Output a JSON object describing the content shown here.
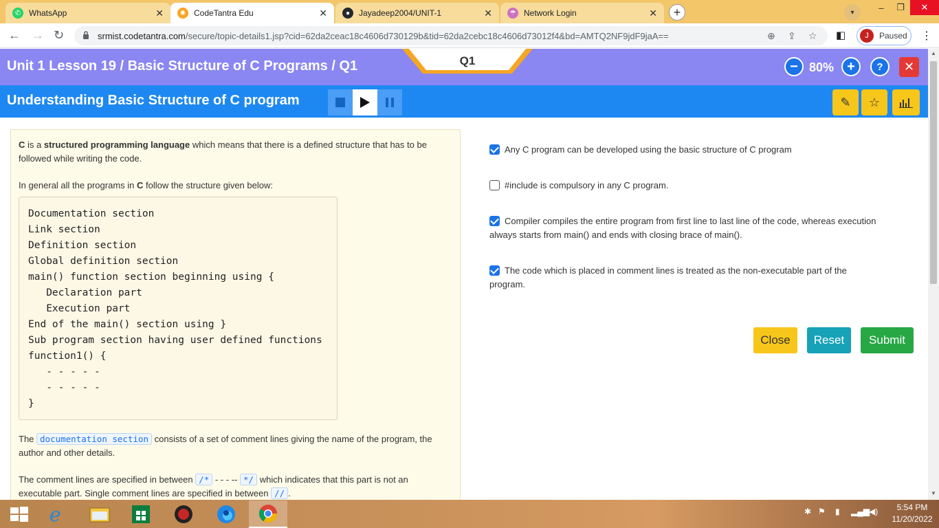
{
  "browser": {
    "tabs": [
      {
        "title": "WhatsApp",
        "icon": "whatsapp-icon",
        "active": false
      },
      {
        "title": "CodeTantra Edu",
        "icon": "codetantra-icon",
        "active": true
      },
      {
        "title": "Jayadeep2004/UNIT-1",
        "icon": "github-icon",
        "active": false
      },
      {
        "title": "Network Login",
        "icon": "network-icon",
        "active": false
      }
    ],
    "url_host": "srmist.codetantra.com",
    "url_path": "/secure/topic-details1.jsp?cid=62da2ceac18c4606d730129b&tid=62da2cebc18c4606d73012f4&bd=AMTQ2NF9jdF9jaA==",
    "profile_initial": "J",
    "profile_status": "Paused"
  },
  "header": {
    "breadcrumb": "Unit 1 Lesson 19 / Basic Structure of C Programs / Q1",
    "question_tab": "Q1",
    "zoom": "80%",
    "help": "?",
    "close": "✕"
  },
  "lesson": {
    "title": "Understanding Basic Structure of C program"
  },
  "content": {
    "p1_bold1": "C",
    "p1_text1": " is a ",
    "p1_bold2": "structured programming language",
    "p1_text2": " which means that there is a defined structure that has to be followed while writing the code.",
    "p2_text1": "In general all the programs in ",
    "p2_bold": "C",
    "p2_text2": " follow the structure given below:",
    "code_lines": [
      "Documentation section",
      "Link section",
      "Definition section",
      "Global definition section",
      "main() function section beginning using {",
      "   Declaration part",
      "   Execution part",
      "End of the main() section using }",
      "Sub program section having user defined functions",
      "function1() {",
      "   - - - - -",
      "   - - - - -",
      "}"
    ],
    "p3_text1": "The ",
    "p3_code": "documentation section",
    "p3_text2": " consists of a set of comment lines giving the name of the program, the author and other details.",
    "p4_text1": "The comment lines are specified in between ",
    "p4_code1": "/*",
    "p4_text2": " - - - -- ",
    "p4_code2": "*/",
    "p4_text3": " which indicates that this part is not an executable part. Single comment lines are specified in between ",
    "p4_code3": "//",
    "p4_text4": "."
  },
  "options": [
    {
      "text": "Any C program can be developed using the basic structure of C program",
      "checked": true
    },
    {
      "text": "#include is compulsory in any C program.",
      "checked": false
    },
    {
      "text": "Compiler compiles the entire program from first line to last line of the code, whereas execution always starts from main() and ends with closing brace of main().",
      "checked": true
    },
    {
      "text": "The code which is placed in comment lines is treated as the non-executable part of the program.",
      "checked": true
    }
  ],
  "buttons": {
    "close": "Close",
    "reset": "Reset",
    "submit": "Submit"
  },
  "taskbar": {
    "time": "5:54 PM",
    "date": "11/20/2022"
  },
  "colors": {
    "topbar": "#8a86f2",
    "lessonbar": "#1e88f2",
    "close_btn": "#f7c61b",
    "reset_btn": "#17a2b8",
    "submit_btn": "#28a745",
    "tab_orange": "#f5a623"
  }
}
